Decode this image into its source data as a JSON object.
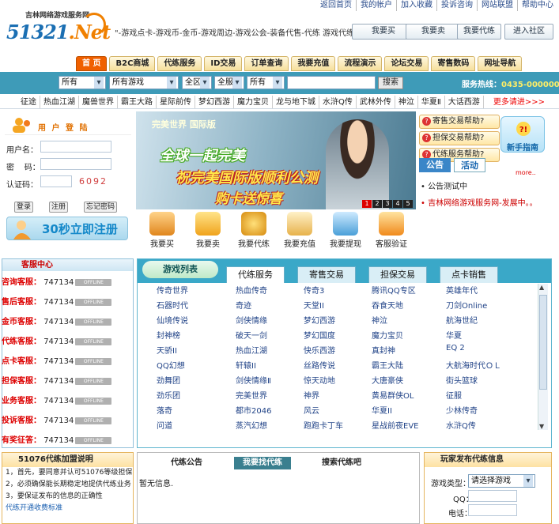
{
  "top_links": [
    "返回首页",
    "我的帐户",
    "加入收藏",
    "投诉咨询",
    "网站联盟",
    "帮助中心"
  ],
  "logo": {
    "cn": "吉林网络游戏服务网",
    "en_num": "51321",
    "en_tail": ".Net"
  },
  "marquee": "\"-游戏点卡-游戏币-金币-游戏周边-游戏公会-装备代售-代练 游戏代练-代练",
  "top_buttons": [
    "我要买",
    "我要卖",
    "我要代练",
    "进入社区"
  ],
  "nav": [
    "首 页",
    "B2C商城",
    "代练服务",
    "ID交易",
    "订单查询",
    "我要充值",
    "流程演示",
    "论坛交易",
    "寄售数码",
    "网址导航"
  ],
  "search": {
    "selects": [
      "所有",
      "所有游戏",
      "全区",
      "全服",
      "所有"
    ],
    "button": "搜索"
  },
  "hotline": {
    "label": "服务热线：",
    "number": "0435-000000"
  },
  "game_nav": [
    "征途",
    "热血江湖",
    "魔兽世界",
    "霸王大路",
    "星际前传",
    "梦幻西游",
    "魔力宝贝",
    "龙与地下城",
    "水浒Q传",
    "武林外传",
    "神泣",
    "华夏Ⅱ",
    "大话西游"
  ],
  "game_nav_more": "更多请进>>>",
  "login": {
    "title": "用 户 登 陆",
    "username_label": "用户名：",
    "password_label": "密    码：",
    "captcha_label": "认证码：",
    "captcha": "6092",
    "btn_login": "登录",
    "btn_register": "注册",
    "btn_forgot": "忘记密码"
  },
  "register_banner": "30秒立即注册",
  "banner": {
    "game_logo": "完美世界 国际版",
    "line1": "全球一起完美",
    "line2": "祝完美国际版顺利公测",
    "line3": "购卡送惊喜",
    "pages": [
      "1",
      "2",
      "3",
      "4",
      "5"
    ],
    "active_page": "1"
  },
  "icon_row": [
    "我要买",
    "我要卖",
    "我要代练",
    "我要充值",
    "我要提现",
    "客服验证"
  ],
  "help": [
    "寄售交易帮助?",
    "担保交易帮助?",
    "代练服务帮助?"
  ],
  "newbie": "新手指南",
  "notice": {
    "tab1": "公告",
    "tab2": "活动",
    "more": "more..",
    "items": [
      "公告测试中",
      "吉林网络游戏服务网-发展中。。"
    ]
  },
  "service": {
    "title": "客服中心",
    "rows": [
      {
        "k": "咨询客服：",
        "qq": "747134"
      },
      {
        "k": "售后客服：",
        "qq": "747134"
      },
      {
        "k": "金币客服：",
        "qq": "747134"
      },
      {
        "k": "代练客服：",
        "qq": "747134"
      },
      {
        "k": "点卡客服：",
        "qq": "747134"
      },
      {
        "k": "担保客服：",
        "qq": "747134"
      },
      {
        "k": "业务客服：",
        "qq": "747134"
      },
      {
        "k": "投诉客服：",
        "qq": "747134"
      },
      {
        "k": "有奖征答：",
        "qq": "747134"
      }
    ],
    "offline": "OFFLINE"
  },
  "game_list": {
    "title": "游戏列表",
    "tabs": [
      "代练服务",
      "寄售交易",
      "担保交易",
      "点卡销售"
    ],
    "games": [
      [
        "传奇世界",
        "热血传奇",
        "传奇3",
        "腾讯QQ专区",
        "英雄年代"
      ],
      [
        "石器时代",
        "奇迹",
        "天堂II",
        "吞食天地",
        "刀剑Online"
      ],
      [
        "仙境传说",
        "剑侠情缘",
        "梦幻西游",
        "神泣",
        "航海世纪"
      ],
      [
        "封神榜",
        "破天一剑",
        "梦幻国度",
        "魔力宝贝",
        "华夏"
      ],
      [
        "天骄II",
        "热血江湖",
        "快乐西游",
        "真封神",
        "EQ 2"
      ],
      [
        "QQ幻想",
        "轩辕II",
        "丝路传说",
        "霸王大陆",
        "大航海时代ＯＬ"
      ],
      [
        "劲舞团",
        "剑侠情缘Ⅱ",
        "惊天动地",
        "大唐豪侠",
        "街头篮球"
      ],
      [
        "劲乐团",
        "完美世界",
        "神界",
        "黄易群侠OL",
        "征服"
      ],
      [
        "落奇",
        "都市2046",
        "风云",
        "华夏II",
        "少林传奇"
      ],
      [
        "问道",
        "蒸汽幻想",
        "跑跑卡丁车",
        "星战前夜EVE",
        "水浒Q传"
      ]
    ]
  },
  "bottom1": {
    "title": "51076代练加盟说明",
    "lines": [
      "1，首先，要同意并认可51076等级担保",
      "2，必须确保能长期稳定地提供代练业务",
      "3，要保证发布的信息的正确性",
      "代练开通收费标准"
    ]
  },
  "bottom2": {
    "tabs": [
      "代练公告",
      "我要找代练",
      "搜索代练吧"
    ],
    "empty": "暂无信息."
  },
  "bottom3": {
    "title": "玩家发布代练信息",
    "type_label": "游戏类型：",
    "type_select": "请选择游戏",
    "qq_label": "QQ：",
    "phone_label": "电话："
  },
  "colors": {
    "teal": "#3e9bb8",
    "orange": "#f06000",
    "red": "#d00000"
  }
}
